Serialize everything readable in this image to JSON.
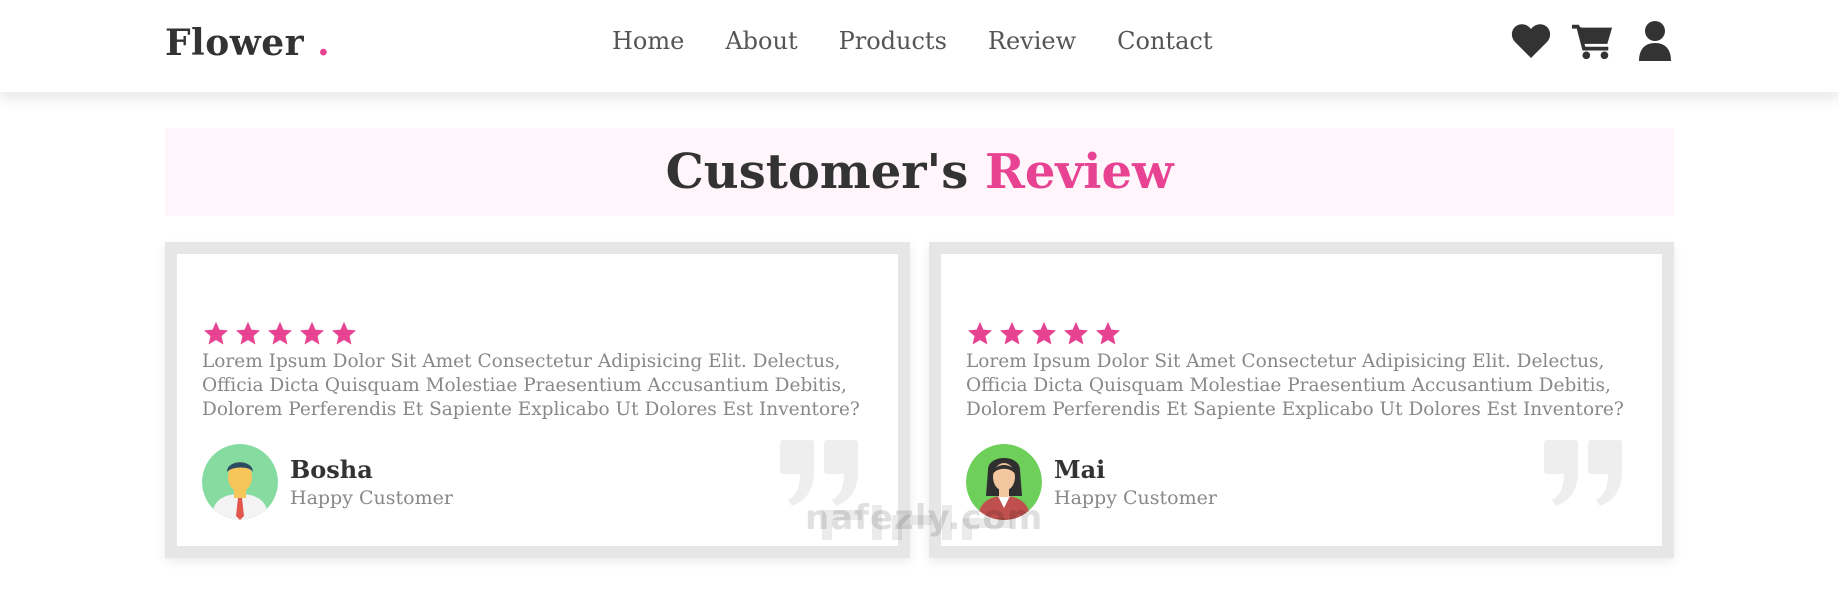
{
  "header": {
    "logo_text": "Flower",
    "logo_dot": ".",
    "nav": [
      "Home",
      "About",
      "Products",
      "Review",
      "Contact"
    ],
    "icons": [
      "heart-icon",
      "cart-icon",
      "user-icon"
    ]
  },
  "section": {
    "title_main": "Customer's",
    "title_accent": "Review"
  },
  "reviews": [
    {
      "stars": 5,
      "text": "Lorem Ipsum Dolor Sit Amet Consectetur Adipisicing Elit. Delectus, Officia Dicta Quisquam Molestiae Praesentium Accusantium Debitis, Dolorem Perferendis Et Sapiente Explicabo Ut Dolores Est Inventore?",
      "name": "Bosha",
      "role": "Happy Customer"
    },
    {
      "stars": 5,
      "text": "Lorem Ipsum Dolor Sit Amet Consectetur Adipisicing Elit. Delectus, Officia Dicta Quisquam Molestiae Praesentium Accusantium Debitis, Dolorem Perferendis Et Sapiente Explicabo Ut Dolores Est Inventore?",
      "name": "Mai",
      "role": "Happy Customer"
    }
  ],
  "watermark": "nafezly.com",
  "colors": {
    "accent": "#e84393",
    "text_dark": "#333333",
    "text_muted": "#888888",
    "card_border": "#e6e6e6",
    "title_band_bg": "#fff5fa"
  }
}
